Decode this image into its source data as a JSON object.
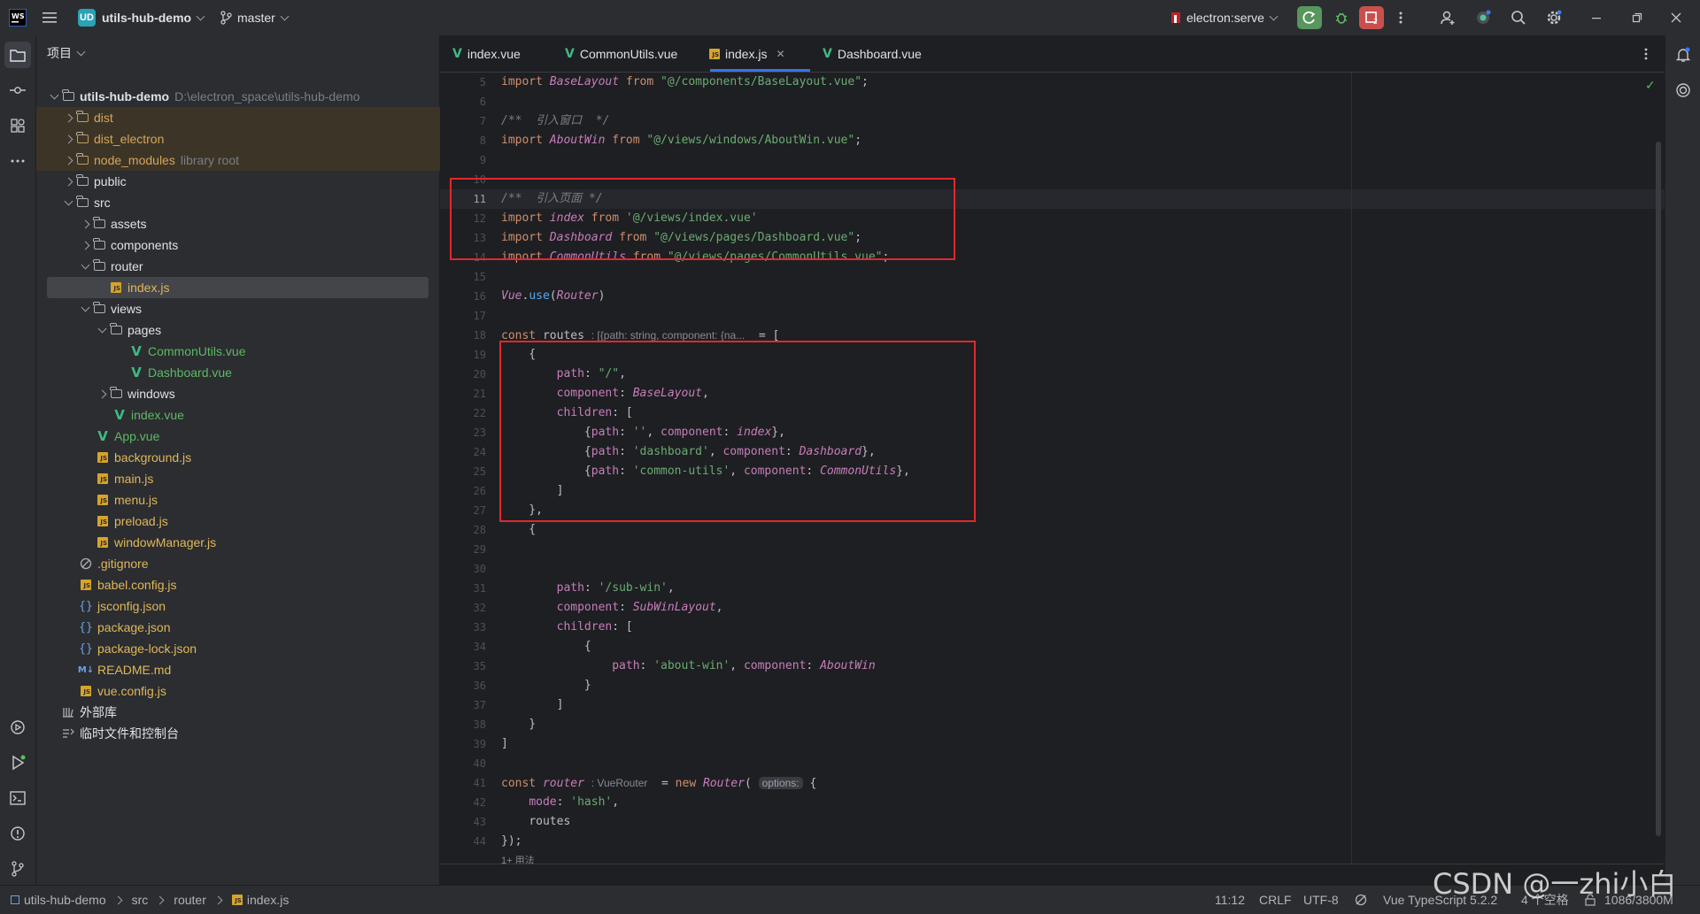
{
  "titlebar": {
    "project_badge": "UD",
    "project_name": "utils-hub-demo",
    "branch": "master",
    "run_config": "electron:serve"
  },
  "project_panel": {
    "title": "项目",
    "root": {
      "name": "utils-hub-demo",
      "path": "D:\\electron_space\\utils-hub-demo"
    },
    "items": [
      {
        "label": "dist",
        "type": "folder"
      },
      {
        "label": "dist_electron",
        "type": "folder"
      },
      {
        "label": "node_modules",
        "type": "folder",
        "note": "library root"
      },
      {
        "label": "public",
        "type": "folder"
      },
      {
        "label": "src",
        "type": "folder"
      },
      {
        "label": "assets",
        "type": "folder"
      },
      {
        "label": "components",
        "type": "folder"
      },
      {
        "label": "router",
        "type": "folder"
      },
      {
        "label": "index.js",
        "type": "js"
      },
      {
        "label": "views",
        "type": "folder"
      },
      {
        "label": "pages",
        "type": "folder"
      },
      {
        "label": "CommonUtils.vue",
        "type": "vue"
      },
      {
        "label": "Dashboard.vue",
        "type": "vue"
      },
      {
        "label": "windows",
        "type": "folder"
      },
      {
        "label": "index.vue",
        "type": "vue"
      },
      {
        "label": "App.vue",
        "type": "vue"
      },
      {
        "label": "background.js",
        "type": "js"
      },
      {
        "label": "main.js",
        "type": "js"
      },
      {
        "label": "menu.js",
        "type": "js"
      },
      {
        "label": "preload.js",
        "type": "js"
      },
      {
        "label": "windowManager.js",
        "type": "js"
      },
      {
        "label": ".gitignore",
        "type": "ignore"
      },
      {
        "label": "babel.config.js",
        "type": "js"
      },
      {
        "label": "jsconfig.json",
        "type": "json"
      },
      {
        "label": "package.json",
        "type": "json"
      },
      {
        "label": "package-lock.json",
        "type": "json"
      },
      {
        "label": "README.md",
        "type": "md"
      },
      {
        "label": "vue.config.js",
        "type": "js"
      },
      {
        "label": "外部库",
        "type": "lib"
      },
      {
        "label": "临时文件和控制台",
        "type": "scratch"
      }
    ]
  },
  "tabs": [
    {
      "label": "index.vue",
      "type": "vue"
    },
    {
      "label": "CommonUtils.vue",
      "type": "vue"
    },
    {
      "label": "index.js",
      "type": "js",
      "active": true
    },
    {
      "label": "Dashboard.vue",
      "type": "vue"
    }
  ],
  "editor": {
    "line_numbers": [
      "5",
      "6",
      "7",
      "8",
      "9",
      "10",
      "11",
      "12",
      "13",
      "14",
      "15",
      "16",
      "17",
      "18",
      "19",
      "20",
      "21",
      "22",
      "23",
      "24",
      "25",
      "26",
      "27",
      "28",
      "29",
      "30",
      "31",
      "32",
      "33",
      "34",
      "35",
      "36",
      "37",
      "38",
      "39",
      "40",
      "41",
      "42",
      "43",
      "44"
    ],
    "tokens": {
      "import": "import",
      "from": "from",
      "const": "const",
      "new": "new",
      "base_layout": "BaseLayout",
      "base_layout_path": "\"@/components/BaseLayout.vue\"",
      "comment_window": "/**  引入窗口  */",
      "about_win": "AboutWin",
      "about_win_path": "\"@/views/windows/AboutWin.vue\"",
      "comment_page": "/**  引入页面 */",
      "index": "index",
      "index_path": "'@/views/index.vue'",
      "dashboard": "Dashboard",
      "dashboard_path": "\"@/views/pages/Dashboard.vue\"",
      "common_utils": "CommonUtils",
      "common_utils_path": "\"@/views/pages/CommonUtils.vue\"",
      "vue": "Vue",
      "use": "use",
      "router_cls": "Router",
      "routes": "routes",
      "routes_hint": ": [{path: string, component: {na...",
      "path": "path",
      "component": "component",
      "children": "children",
      "root_path": "\"/\"",
      "empty_path": "''",
      "dashboard_str": "'dashboard'",
      "common_utils_str": "'common-utils'",
      "sub_win_path": "'/sub-win'",
      "sub_win_layout": "SubWinLayout",
      "about_win_str": "'about-win'",
      "router_var": "router",
      "router_hint": ": VueRouter",
      "options_hint": "options:",
      "mode": "mode",
      "hash": "'hash'",
      "usages": "1+ 用法"
    }
  },
  "statusbar": {
    "breadcrumb": [
      "utils-hub-demo",
      "src",
      "router",
      "index.js"
    ],
    "position": "11:12",
    "line_sep": "CRLF",
    "encoding": "UTF-8",
    "lang": "Vue TypeScript 5.2.2",
    "indent": "4 个空格",
    "memory": "1086/3800M"
  },
  "watermark": "CSDN @一zhi小白"
}
